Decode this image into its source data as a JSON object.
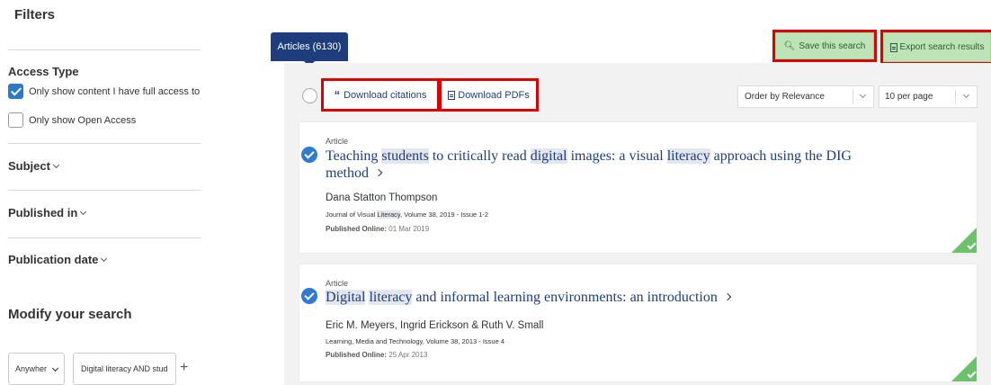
{
  "sidebar": {
    "filters_title": "Filters",
    "access_type": {
      "title": "Access Type",
      "options": [
        {
          "label": "Only show content I have full access to",
          "checked": true
        },
        {
          "label": "Only show Open Access",
          "checked": false
        }
      ]
    },
    "groups": [
      "Subject",
      "Published in",
      "Publication date"
    ],
    "modify_title": "Modify your search",
    "search_field_select": "Anywher",
    "search_query": "Digital literacy AND stud",
    "add_label": "+"
  },
  "main": {
    "articles_tab": "Articles (6130)",
    "save_search": "Save this search",
    "export_results": "Export search results",
    "download_citations": "Download citations",
    "download_pdfs": "Download PDFs",
    "order_by": "Order by Relevance",
    "per_page": "10 per page",
    "results": [
      {
        "type": "Article",
        "title_parts": [
          {
            "text": "Teaching ",
            "hl": false
          },
          {
            "text": "students",
            "hl": true
          },
          {
            "text": " to critically read ",
            "hl": false
          },
          {
            "text": "digital",
            "hl": true
          },
          {
            "text": " images: a visual ",
            "hl": false
          },
          {
            "text": "literacy",
            "hl": true
          },
          {
            "text": " approach using the DIG",
            "hl": false
          }
        ],
        "title_line2": "method",
        "authors": "Dana Statton Thompson",
        "journal_prefix": "Journal of Visual ",
        "journal_hl": "Literacy",
        "journal_suffix": ", Volume 38, 2019 - Issue 1-2",
        "published_label": "Published Online:",
        "published_date": " 01 Mar 2019"
      },
      {
        "type": "Article",
        "title_parts": [
          {
            "text": "Digital",
            "hl": true
          },
          {
            "text": " ",
            "hl": false
          },
          {
            "text": "literacy",
            "hl": true
          },
          {
            "text": " and informal learning environments: an introduction",
            "hl": false
          }
        ],
        "authors": "Eric M. Meyers, Ingrid Erickson & Ruth V. Small",
        "journal_prefix": "Learning, Media and Technology, Volume 38, 2013 - Issue 4",
        "published_label": "Published Online:",
        "published_date": " 25 Apr 2013"
      }
    ]
  },
  "colors": {
    "brand_navy": "#1d3d7d",
    "accent_green": "#bfe3b9",
    "highlight_box": "#e00000",
    "checkbox_blue": "#2c79c6"
  }
}
